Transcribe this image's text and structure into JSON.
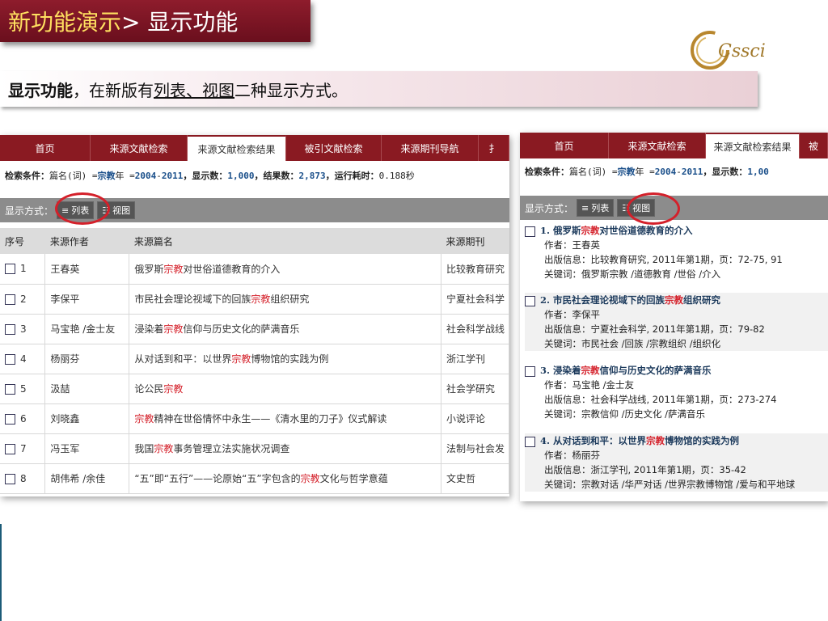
{
  "slide": {
    "title_accent": "新功能演示",
    "title_rest": "> 显示功能",
    "logo_text": "Cssci",
    "subtitle_bold": "显示功能",
    "subtitle_plain": "，在新版有",
    "subtitle_underlined": "列表、视图",
    "subtitle_tail": "二种显示方式。"
  },
  "colors": {
    "brand": "#8a1a22",
    "highlight": "#d4202a",
    "link": "#1a4f8a"
  },
  "list_panel": {
    "tabs": [
      "首页",
      "来源文献检索",
      "来源文献检索结果",
      "被引文献检索",
      "来源期刊导航",
      "扌"
    ],
    "active_tab": 2,
    "cond": {
      "label": "检索条件：",
      "field": "篇名(词) = ",
      "keyword": "宗教",
      "year_label": " 年 = ",
      "year_from": "2004",
      "dash": " - ",
      "year_to": "2011",
      "shown_label": "，显示数：",
      "shown": "1,000",
      "result_label": "，结果数：",
      "result": "2,873",
      "time_label": "，运行耗时：",
      "time": "0.188秒"
    },
    "mode_label": "显示方式：",
    "mode_list": "列表",
    "mode_view": "视图",
    "headers": [
      "序号",
      "来源作者",
      "来源篇名",
      "来源期刊"
    ],
    "rows": [
      {
        "no": "1",
        "author": "王春英",
        "t1": "俄罗斯",
        "hl": "宗教",
        "t2": "对世俗道德教育的介入",
        "journal": "比较教育研究"
      },
      {
        "no": "2",
        "author": "李保平",
        "t1": "市民社会理论视域下的回族",
        "hl": "宗教",
        "t2": "组织研究",
        "journal": "宁夏社会科学"
      },
      {
        "no": "3",
        "author": "马宝艳 /金士友",
        "t1": "浸染着",
        "hl": "宗教",
        "t2": "信仰与历史文化的萨满音乐",
        "journal": "社会科学战线"
      },
      {
        "no": "4",
        "author": "杨丽芬",
        "t1": "从对话到和平：以世界",
        "hl": "宗教",
        "t2": "博物馆的实践为例",
        "journal": "浙江学刊"
      },
      {
        "no": "5",
        "author": "汲喆",
        "t1": "论公民",
        "hl": "宗教",
        "t2": "",
        "journal": "社会学研究"
      },
      {
        "no": "6",
        "author": "刘晓鑫",
        "t1": "",
        "hl": "宗教",
        "t2": "精神在世俗情怀中永生——《清水里的刀子》仪式解读",
        "journal": "小说评论"
      },
      {
        "no": "7",
        "author": "冯玉军",
        "t1": "我国",
        "hl": "宗教",
        "t2": "事务管理立法实施状况调查",
        "journal": "法制与社会发"
      },
      {
        "no": "8",
        "author": "胡伟希 /余佳",
        "t1": "“五”即“五行”——论原始“五”字包含的",
        "hl": "宗教",
        "t2": "文化与哲学意蕴",
        "journal": "文史哲"
      }
    ]
  },
  "view_panel": {
    "tabs": [
      "首页",
      "来源文献检索",
      "来源文献检索结果",
      "被"
    ],
    "active_tab": 2,
    "cond": {
      "label": "检索条件：",
      "field": "篇名(词) = ",
      "keyword": "宗教",
      "year_label": " 年 = ",
      "year_from": "2004",
      "dash": " - ",
      "year_to": "2011",
      "shown_label": "，显示数：",
      "shown": "1,00"
    },
    "mode_label": "显示方式：",
    "mode_list": "列表",
    "mode_view": "视图",
    "entries": [
      {
        "t1": "1. 俄罗斯",
        "hl": "宗教",
        "t2": "对世俗道德教育的介入",
        "author": "作者：王春英",
        "pub": "出版信息：比较教育研究, 2011年第1期，页：72-75, 91",
        "kw": "关键词：俄罗斯宗教 /道德教育 /世俗 /介入"
      },
      {
        "t1": "2. 市民社会理论视域下的回族",
        "hl": "宗教",
        "t2": "组织研究",
        "author": "作者：李保平",
        "pub": "出版信息：宁夏社会科学, 2011年第1期，页：79-82",
        "kw": "关键词：市民社会 /回族 /宗教组织 /组织化"
      },
      {
        "t1": "3. 浸染着",
        "hl": "宗教",
        "t2": "信仰与历史文化的萨满音乐",
        "author": "作者：马宝艳 /金士友",
        "pub": "出版信息：社会科学战线, 2011年第1期，页：273-274",
        "kw": "关键词：宗教信仰 /历史文化 /萨满音乐"
      },
      {
        "t1": "4. 从对话到和平：以世界",
        "hl": "宗教",
        "t2": "博物馆的实践为例",
        "author": "作者：杨丽芬",
        "pub": "出版信息：浙江学刊, 2011年第1期，页：35-42",
        "kw": "关键词：宗教对话 /华严对话 /世界宗教博物馆 /爱与和平地球"
      }
    ]
  }
}
